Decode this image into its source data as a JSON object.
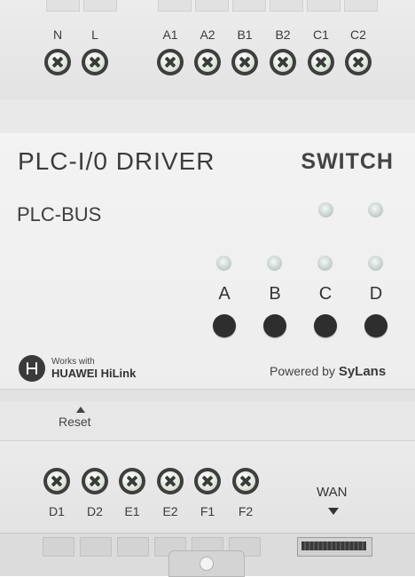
{
  "top_terminals": [
    {
      "label": "N"
    },
    {
      "label": "L"
    },
    {
      "label": "A1"
    },
    {
      "label": "A2"
    },
    {
      "label": "B1"
    },
    {
      "label": "B2"
    },
    {
      "label": "C1"
    },
    {
      "label": "C2"
    }
  ],
  "front": {
    "title": "PLC-I/0 DRIVER",
    "brand": "SWITCH",
    "bus_label": "PLC-BUS",
    "channels": [
      {
        "label": "A"
      },
      {
        "label": "B"
      },
      {
        "label": "C"
      },
      {
        "label": "D"
      }
    ]
  },
  "badges": {
    "hilink_top": "Works with",
    "hilink_bottom": "HUAWEI HiLink",
    "powered_prefix": "Powered by ",
    "powered_brand": "SyLans"
  },
  "reset_label": "Reset",
  "bottom_terminals": [
    {
      "label": "D1"
    },
    {
      "label": "D2"
    },
    {
      "label": "E1"
    },
    {
      "label": "E2"
    },
    {
      "label": "F1"
    },
    {
      "label": "F2"
    }
  ],
  "wan_label": "WAN",
  "colors": {
    "body": "#ededed",
    "screw": "#3e3e3e",
    "led": "#bccac7",
    "button": "#2e2e2e"
  }
}
